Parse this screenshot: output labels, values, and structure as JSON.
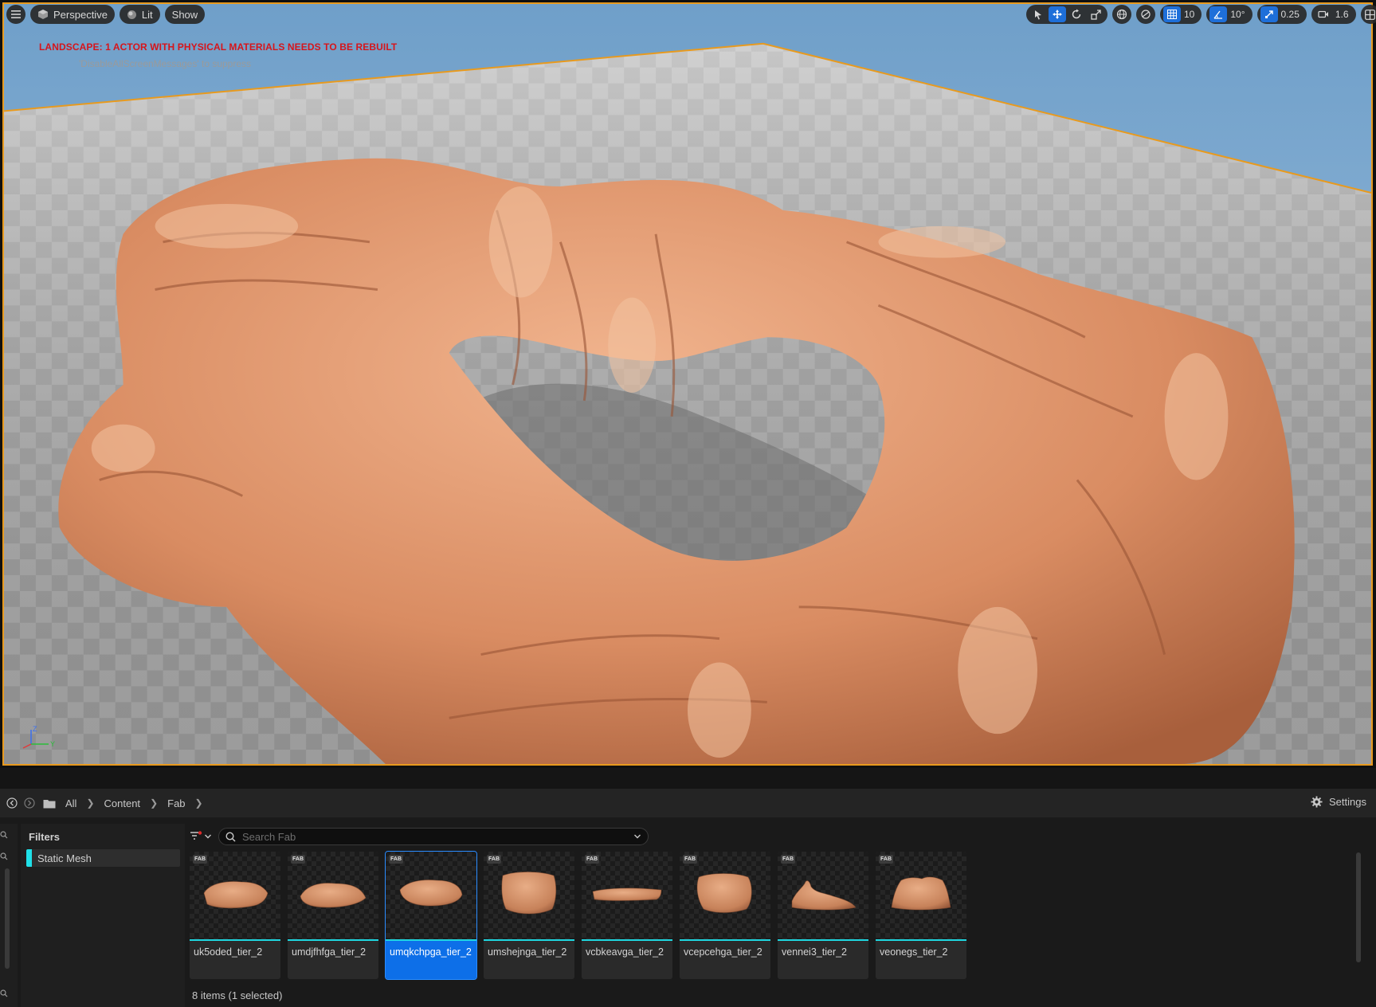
{
  "viewport": {
    "menu_icon": "hamburger-icon",
    "perspective_label": "Perspective",
    "lit_label": "Lit",
    "show_label": "Show",
    "grid_snap_value": "10",
    "rotation_snap_value": "10°",
    "scale_snap_value": "0.25",
    "camera_speed_value": "1.6",
    "warning_message": "LANDSCAPE: 1 ACTOR WITH PHYSICAL MATERIALS NEEDS TO BE REBUILT",
    "suppress_message": "'DisableAllScreenMessages' to suppress",
    "axis_labels": {
      "z": "Z",
      "y": "Y"
    },
    "colors": {
      "selection_outline": "#e89a1e",
      "warning_text": "#d6151b",
      "active_tool": "#1e6fd9"
    }
  },
  "content_browser": {
    "breadcrumb": [
      "All",
      "Content",
      "Fab"
    ],
    "settings_label": "Settings",
    "filters_title": "Filters",
    "filter_chip_label": "Static Mesh",
    "search_placeholder": "Search Fab",
    "badge_text": "FAB",
    "assets": [
      {
        "name": "uk5oded_tier_2",
        "selected": false
      },
      {
        "name": "umdjfhfga_tier_2",
        "selected": false
      },
      {
        "name": "umqkchpga_tier_2",
        "selected": true
      },
      {
        "name": "umshejnga_tier_2",
        "selected": false
      },
      {
        "name": "vcbkeavga_tier_2",
        "selected": false
      },
      {
        "name": "vcepcehga_tier_2",
        "selected": false
      },
      {
        "name": "vennei3_tier_2",
        "selected": false
      },
      {
        "name": "veonegs_tier_2",
        "selected": false
      }
    ],
    "status_text": "8 items (1 selected)",
    "colors": {
      "static_mesh": "#1fe0e8",
      "selection": "#0d6fe8"
    }
  }
}
